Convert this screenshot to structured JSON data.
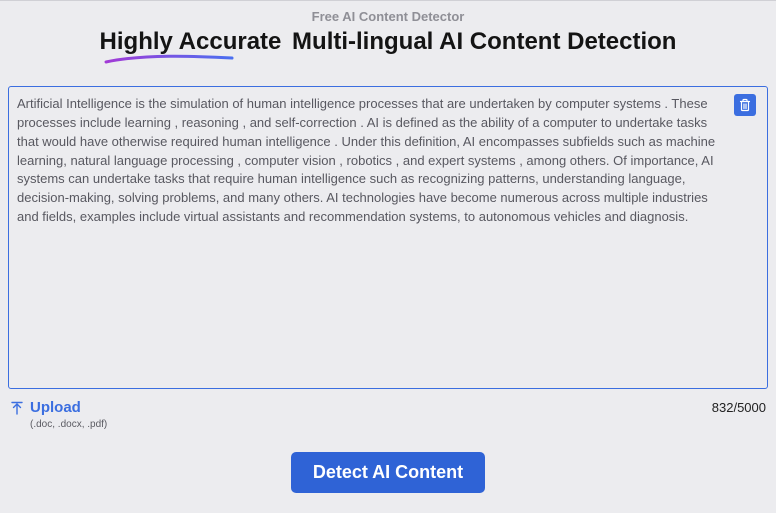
{
  "header": {
    "top_label": "Free AI Content Detector",
    "headline_emph": "Highly Accurate",
    "headline_rest": " Multi-lingual AI Content Detection"
  },
  "editor": {
    "text": "Artificial Intelligence is the simulation of human intelligence processes that are undertaken by computer systems . These processes include learning , reasoning , and self-correction . AI is defined as the ability of a computer to undertake tasks that would have otherwise required human intelligence . Under this definition, AI encompasses subfields such as machine learning, natural language processing , computer vision , robotics , and expert systems , among others. Of importance, AI systems can undertake tasks that require human intelligence such as recognizing patterns, understanding language, decision-making, solving problems, and many others. AI technologies have become numerous across multiple industries and fields, examples include virtual assistants and recommendation systems, to autonomous vehicles and diagnosis.",
    "placeholder": ""
  },
  "upload": {
    "label": "Upload",
    "formats": "(.doc, .docx, .pdf)"
  },
  "counter": {
    "current": "832",
    "max": "5000"
  },
  "actions": {
    "detect_label": "Detect AI Content"
  },
  "colors": {
    "accent": "#3b6ee0"
  }
}
